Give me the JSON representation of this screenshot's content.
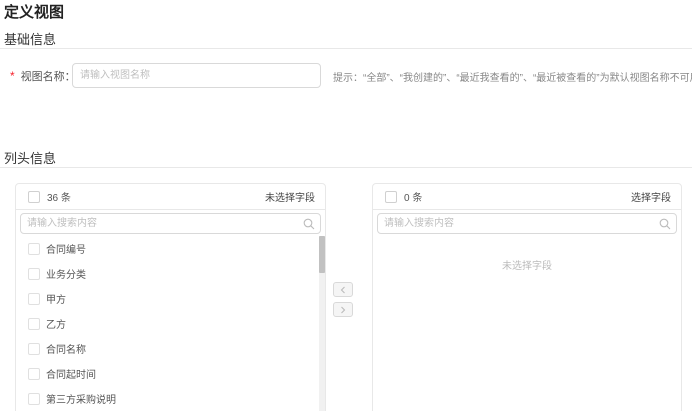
{
  "page": {
    "title": "定义视图"
  },
  "basic_section": {
    "title": "基础信息",
    "required_mark": "*",
    "name_label": "视图名称：",
    "name_value": "",
    "name_placeholder": "请输入视图名称",
    "hint": "提示：“全部”、“我创建的”、“最近我查看的”、“最近被查看的”为默认视图名称不可用。"
  },
  "columns_section": {
    "title": "列头信息",
    "left_panel": {
      "count": "36 条",
      "title": "未选择字段",
      "search_placeholder": "请输入搜索内容",
      "search_icon": "search-icon",
      "items": [
        {
          "label": "合同编号"
        },
        {
          "label": "业务分类"
        },
        {
          "label": "甲方"
        },
        {
          "label": "乙方"
        },
        {
          "label": "合同名称"
        },
        {
          "label": "合同起时间"
        },
        {
          "label": "第三方采购说明"
        }
      ]
    },
    "right_panel": {
      "count": "0 条",
      "title": "选择字段",
      "search_placeholder": "请输入搜索内容",
      "search_icon": "search-icon",
      "empty_text": "未选择字段"
    },
    "transfer_buttons": {
      "to_left_icon": "chevron-left-icon",
      "to_right_icon": "chevron-right-icon"
    }
  },
  "colors": {
    "required": "#f5222d",
    "border": "#d9d9d9",
    "placeholder": "#bfbfbf"
  }
}
